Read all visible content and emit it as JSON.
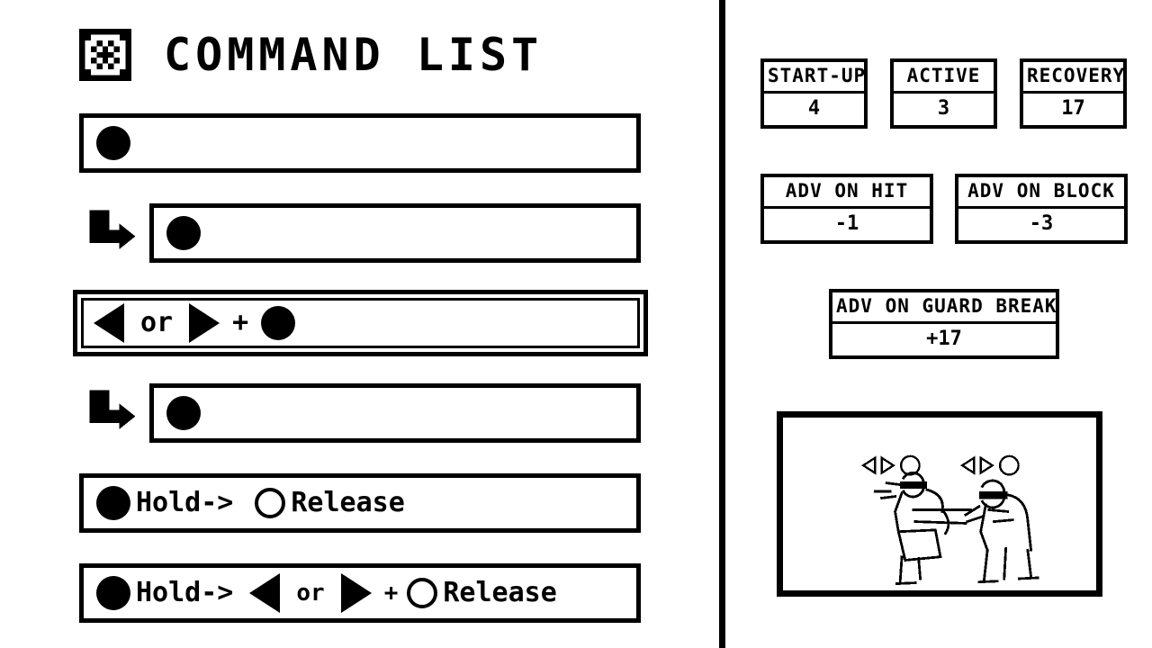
{
  "header": {
    "title": "COMMAND LIST",
    "icon": "target-diamond-icon"
  },
  "commands": [
    {
      "id": "cmd-1",
      "indent": 0,
      "selected": false,
      "prefix_arrow": false,
      "tokens": [
        {
          "type": "button-filled",
          "label": "●"
        }
      ]
    },
    {
      "id": "cmd-2",
      "indent": 1,
      "selected": false,
      "prefix_arrow": true,
      "tokens": [
        {
          "type": "button-filled",
          "label": "●"
        }
      ]
    },
    {
      "id": "cmd-3",
      "indent": 0,
      "selected": true,
      "prefix_arrow": false,
      "tokens": [
        {
          "type": "dir-left",
          "label": "◀"
        },
        {
          "type": "text",
          "label": "or"
        },
        {
          "type": "dir-right",
          "label": "▶"
        },
        {
          "type": "text",
          "label": "+"
        },
        {
          "type": "button-filled",
          "label": "●"
        }
      ]
    },
    {
      "id": "cmd-4",
      "indent": 1,
      "selected": false,
      "prefix_arrow": true,
      "tokens": [
        {
          "type": "button-filled",
          "label": "●"
        }
      ]
    },
    {
      "id": "cmd-5",
      "indent": 0,
      "selected": false,
      "prefix_arrow": false,
      "tokens": [
        {
          "type": "button-filled",
          "label": "●"
        },
        {
          "type": "text",
          "label": "Hold->"
        },
        {
          "type": "button-hollow",
          "label": "○"
        },
        {
          "type": "text",
          "label": "Release"
        }
      ]
    },
    {
      "id": "cmd-6",
      "indent": 0,
      "selected": false,
      "prefix_arrow": false,
      "tokens": [
        {
          "type": "button-filled",
          "label": "●"
        },
        {
          "type": "text",
          "label": "Hold->"
        },
        {
          "type": "dir-left",
          "label": "◀"
        },
        {
          "type": "text",
          "label": "or"
        },
        {
          "type": "dir-right",
          "label": "▶"
        },
        {
          "type": "text",
          "label": "+"
        },
        {
          "type": "button-hollow",
          "label": "○"
        },
        {
          "type": "text",
          "label": "Release"
        }
      ]
    }
  ],
  "stats": {
    "startup": {
      "label": "START-UP",
      "value": "4"
    },
    "active": {
      "label": "ACTIVE",
      "value": "3"
    },
    "recovery": {
      "label": "RECOVERY",
      "value": "17"
    },
    "adv_hit": {
      "label": "ADV ON HIT",
      "value": "-1"
    },
    "adv_block": {
      "label": "ADV ON BLOCK",
      "value": "-3"
    },
    "adv_gb": {
      "label": "ADV ON GUARD BREAK",
      "value": "+17"
    }
  },
  "preview": {
    "name": "move-preview-illustration",
    "fighter_inputs": [
      {
        "notation": "◁▷○"
      },
      {
        "notation": "◁▷○"
      }
    ]
  },
  "colors": {
    "foreground": "#000000",
    "background": "#ffffff"
  }
}
